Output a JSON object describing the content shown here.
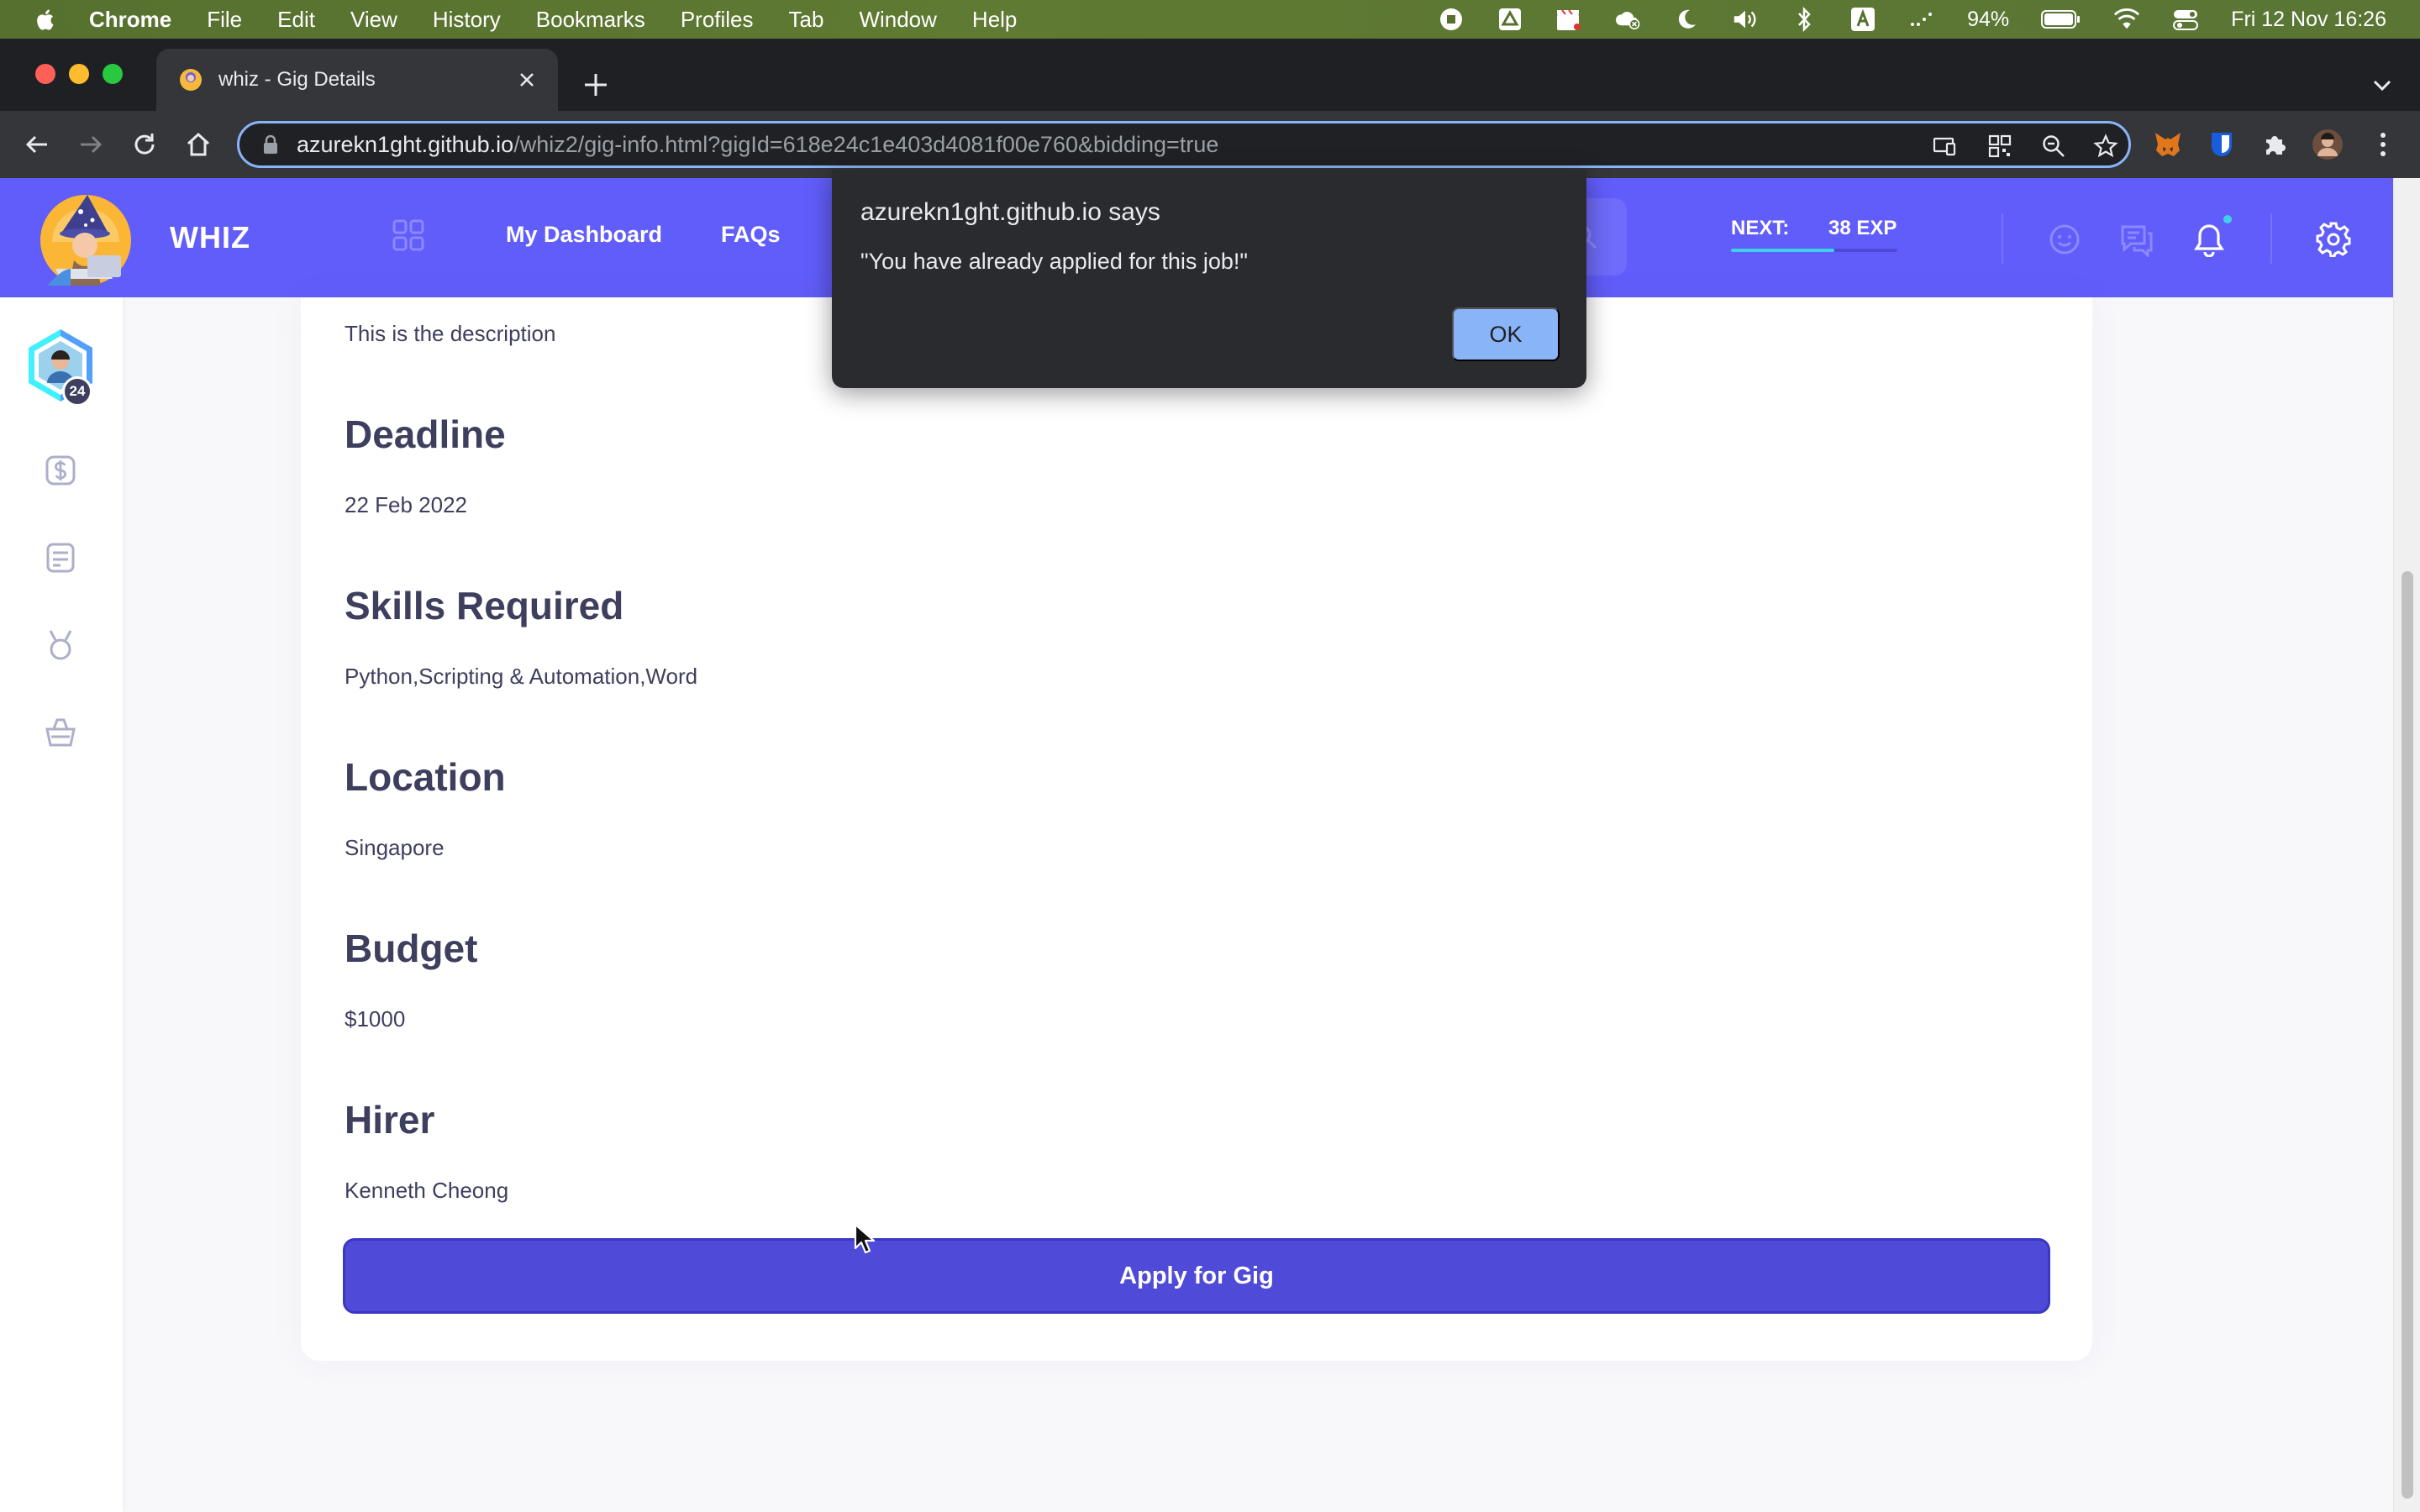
{
  "menubar": {
    "app_name": "Chrome",
    "items": [
      "File",
      "Edit",
      "View",
      "History",
      "Bookmarks",
      "Profiles",
      "Tab",
      "Window",
      "Help"
    ],
    "battery": "94%",
    "datetime": "Fri 12 Nov  16:26"
  },
  "browser": {
    "tab_title": "whiz - Gig Details",
    "url_host": "azurekn1ght.github.io",
    "url_path": "/whiz2/gig-info.html?gigId=618e24c1e403d4081f00e760&bidding=true"
  },
  "site": {
    "brand": "WHIZ",
    "nav": [
      "My Dashboard",
      "FAQs"
    ],
    "next_label": "NEXT:",
    "exp_label": "38 EXP",
    "exp_progress": 0.62,
    "level_badge": "24",
    "colors": {
      "header": "#615dfa",
      "button": "#4f4bd8",
      "exp_fill": "#40d0e8"
    }
  },
  "gig": {
    "description": "This is the description",
    "deadline_heading": "Deadline",
    "deadline": "22 Feb 2022",
    "skills_heading": "Skills Required",
    "skills": "Python,Scripting & Automation,Word",
    "location_heading": "Location",
    "location": "Singapore",
    "budget_heading": "Budget",
    "budget": "$1000",
    "hirer_heading": "Hirer",
    "hirer": "Kenneth Cheong",
    "apply_label": "Apply for Gig"
  },
  "alert": {
    "title": "azurekn1ght.github.io says",
    "message": "\"You have already applied for this job!\"",
    "ok_label": "OK"
  }
}
